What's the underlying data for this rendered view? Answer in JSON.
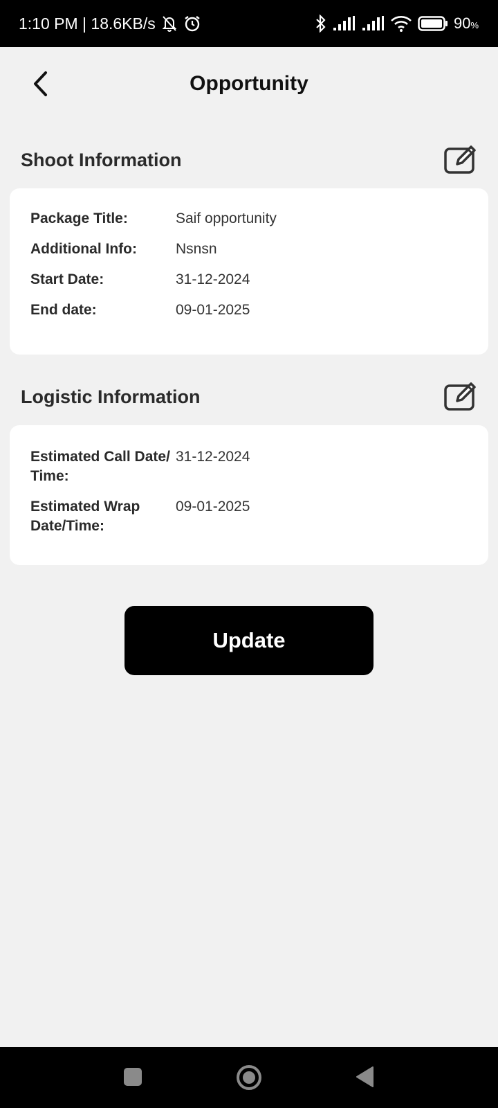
{
  "status_bar": {
    "time_speed": "1:10 PM | 18.6KB/s",
    "battery_percent": "90",
    "battery_unit": "%",
    "icons": [
      "mute-bell-icon",
      "alarm-icon",
      "bluetooth-icon",
      "signal-icon",
      "signal-icon",
      "wifi-icon",
      "battery-icon"
    ]
  },
  "header": {
    "title": "Opportunity",
    "back_icon": "chevron-left-icon"
  },
  "shoot_info": {
    "title": "Shoot Information",
    "edit_icon": "edit-icon",
    "rows": [
      {
        "label": "Package Title:",
        "value": "Saif opportunity"
      },
      {
        "label": "Additional Info:",
        "value": "Nsnsn"
      },
      {
        "label": "Start Date:",
        "value": "31-12-2024"
      },
      {
        "label": "End date:",
        "value": "09-01-2025"
      }
    ]
  },
  "logistic_info": {
    "title": "Logistic Information",
    "edit_icon": "edit-icon",
    "rows": [
      {
        "label": "Estimated Call Date/ Time:",
        "value": "31-12-2024"
      },
      {
        "label": "Estimated Wrap Date/Time:",
        "value": "09-01-2025"
      }
    ]
  },
  "actions": {
    "update_label": "Update"
  },
  "nav_bar": {
    "icons": [
      "recents-square-icon",
      "home-circle-icon",
      "back-triangle-icon"
    ]
  }
}
